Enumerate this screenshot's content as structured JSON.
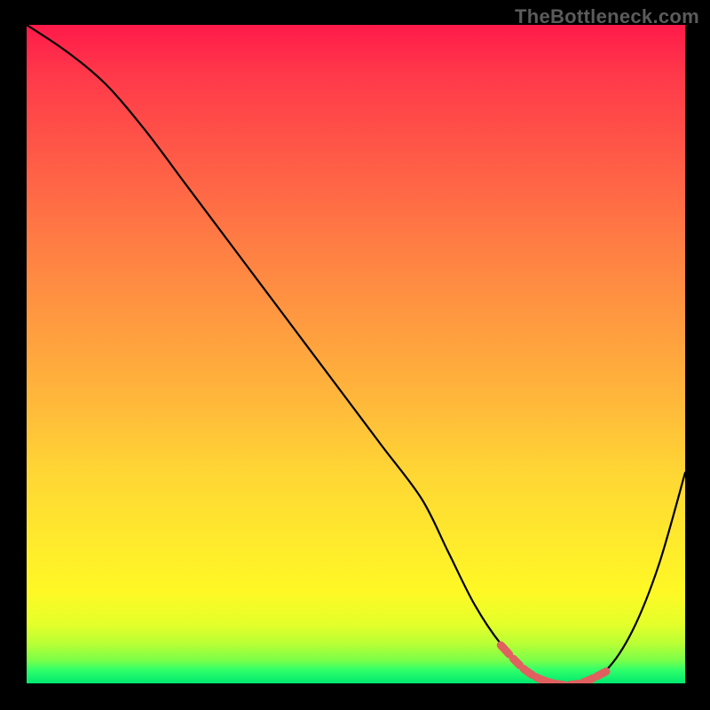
{
  "watermark": "TheBottleneck.com",
  "chart_data": {
    "type": "line",
    "title": "",
    "xlabel": "",
    "ylabel": "",
    "xlim": [
      0,
      100
    ],
    "ylim": [
      0,
      100
    ],
    "series": [
      {
        "name": "curve",
        "x": [
          0,
          6,
          12,
          18,
          24,
          30,
          36,
          42,
          48,
          54,
          60,
          64,
          68,
          72,
          76,
          80,
          84,
          88,
          92,
          96,
          100
        ],
        "values": [
          100,
          96,
          91,
          84,
          76,
          68,
          60,
          52,
          44,
          36,
          28,
          20,
          12,
          6,
          2,
          0,
          0,
          2,
          8,
          18,
          32
        ]
      }
    ],
    "colors": {
      "gradient_top": "#ff1a4a",
      "gradient_mid": "#ffe92d",
      "gradient_bottom": "#00e86e",
      "curve": "#000000",
      "accent": "#e06060",
      "background": "#000000"
    },
    "annotations": {
      "min_region_x": [
        72,
        88
      ]
    }
  }
}
